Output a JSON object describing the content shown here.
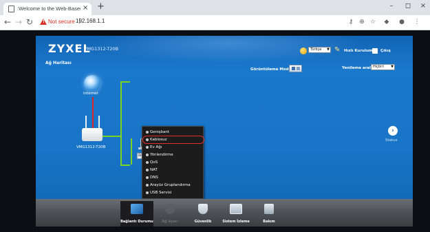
{
  "browser": {
    "tab_title": ":Welcome to the Web-Based Co",
    "tab_close": "×",
    "new_tab": "+",
    "window_controls": [
      "–",
      "◻",
      "×"
    ],
    "security_text": "Not secure",
    "url": "192.168.1.1",
    "toolbar_icons": [
      "key-icon",
      "zoom-icon",
      "star-icon",
      "extension-icon",
      "account-icon",
      "menu-icon"
    ]
  },
  "router": {
    "logo": "ZYXEL",
    "model": "VMG1312-T20B",
    "page_title": "Ağ Haritası",
    "language": "Türkçe",
    "wizard_label": "Hızlı Kurulum",
    "logout_label": "Çıkış",
    "view_mode_label": "Görüntüleme Modu",
    "refresh_label": "Yenileme aralığı",
    "refresh_value": "Hiçbiri",
    "internet_label": "Internet",
    "device_label": "VMG1312-T20B",
    "unknown_device_label": "Bilinmeyen",
    "status_label": "Status"
  },
  "menu_items": [
    "Genişbant",
    "Kablosuz",
    "Ev Ağı",
    "Yönlendirme",
    "QoS",
    "NAT",
    "DNS",
    "Arayüz Gruplandırma",
    "USB Servisi"
  ],
  "menu_selected": "Kablosuz",
  "bottom_nav": [
    {
      "label": "Bağlantı Durumu",
      "active": true,
      "enabled": true
    },
    {
      "label": "Ağ Ayarı",
      "active": false,
      "enabled": false
    },
    {
      "label": "Güvenlik",
      "active": false,
      "enabled": true
    },
    {
      "label": "Sistem İzleme",
      "active": false,
      "enabled": true
    },
    {
      "label": "Bakım",
      "active": false,
      "enabled": true
    }
  ],
  "colors": {
    "router_blue": "#1874c6",
    "lan_green": "#7ed321",
    "wan_red": "#e02424",
    "menu_bg": "#1c1c1c",
    "highlight_red": "#e32b2b",
    "warning_red": "#d93025"
  }
}
